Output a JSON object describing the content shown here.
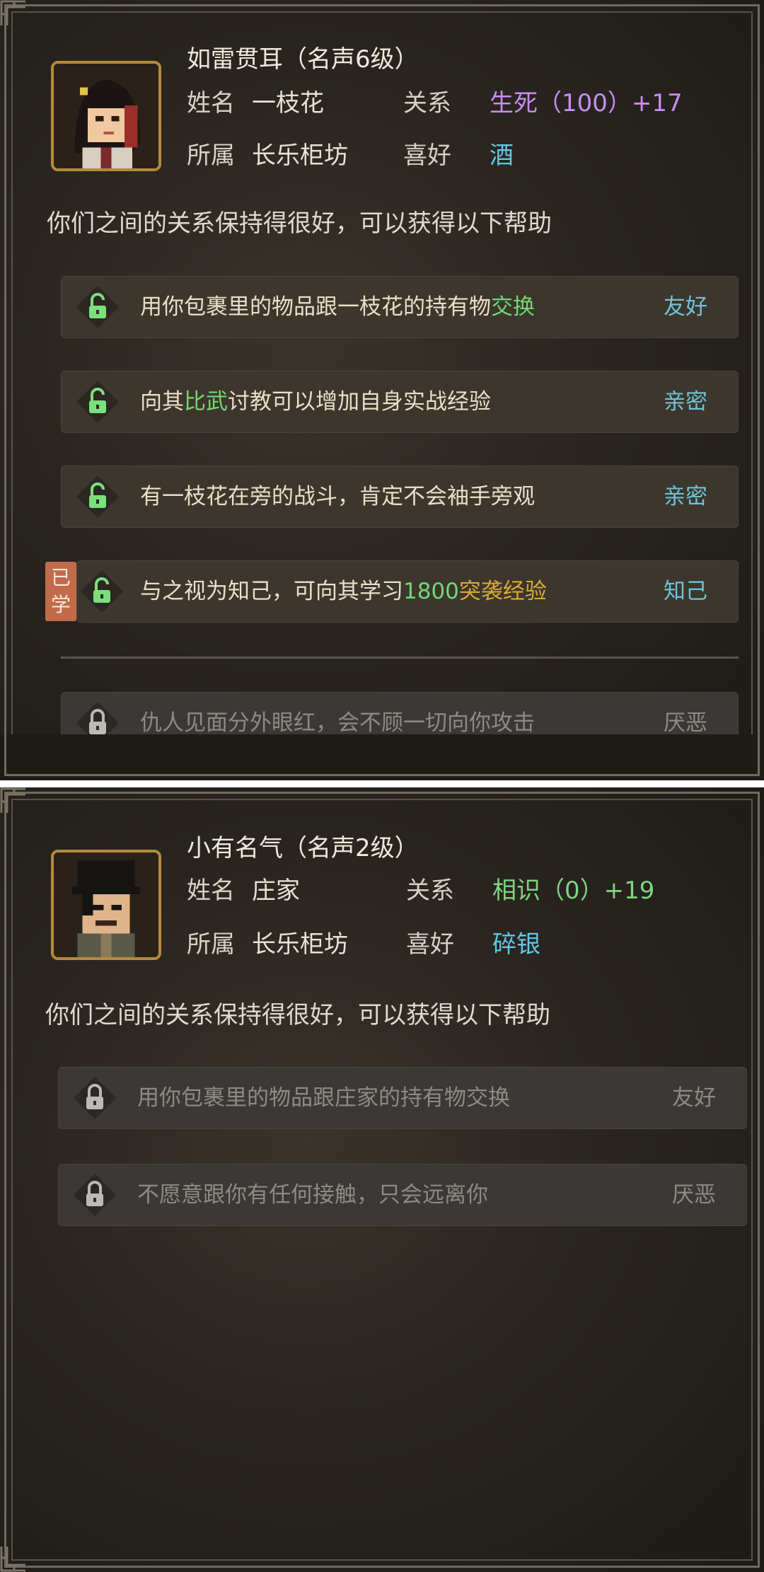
{
  "panels": [
    {
      "fame_title": "如雷贯耳（名声6级）",
      "name_label": "姓名",
      "name_value": "一枝花",
      "relation_label": "关系",
      "relation_value": "生死（100）+17",
      "faction_label": "所属",
      "faction_value": "长乐柜坊",
      "hobby_label": "喜好",
      "hobby_value": "酒",
      "help_text": "你们之间的关系保持得很好，可以获得以下帮助",
      "learned_badge": "已学",
      "rows": [
        {
          "pre": "用你包裹里的物品跟一枝花的持有物",
          "hl1": "交换",
          "mid": "",
          "hl2": "",
          "tag": "友好"
        },
        {
          "pre": "向其",
          "hl1": "比武",
          "mid": "讨教可以增加自身实战经验",
          "hl2": "",
          "tag": "亲密"
        },
        {
          "pre": "有一枝花在旁的战斗，肯定不会袖手旁观",
          "hl1": "",
          "mid": "",
          "hl2": "",
          "tag": "亲密"
        },
        {
          "pre": "与之视为知己，可向其学习",
          "hl1": "1800",
          "mid": "",
          "hl2": "突袭经验",
          "tag": "知己"
        },
        {
          "pre": "仇人见面分外眼红，会不顾一切向你攻击",
          "hl1": "",
          "mid": "",
          "hl2": "",
          "tag": "厌恶"
        }
      ]
    },
    {
      "fame_title": "小有名气（名声2级）",
      "name_label": "姓名",
      "name_value": "庄家",
      "relation_label": "关系",
      "relation_value": "相识（0）+19",
      "faction_label": "所属",
      "faction_value": "长乐柜坊",
      "hobby_label": "喜好",
      "hobby_value": "碎银",
      "help_text": "你们之间的关系保持得很好，可以获得以下帮助",
      "rows": [
        {
          "text": "用你包裹里的物品跟庄家的持有物交换",
          "tag": "友好"
        },
        {
          "text": "不愿意跟你有任何接触，只会远离你",
          "tag": "厌恶"
        }
      ]
    }
  ],
  "icons": {
    "lock_unlocked": "lock-open-icon",
    "lock_locked": "lock-closed-icon",
    "portrait_1": "female-swordsman-portrait",
    "portrait_2": "dealer-portrait"
  },
  "colors": {
    "relation_deep": "#c78ef0",
    "relation_acquaint": "#7fd47f",
    "hobby": "#5ec9e6",
    "highlight_green": "#74d774",
    "highlight_gold": "#d9aa35",
    "learned_badge": "#c36a4a"
  }
}
